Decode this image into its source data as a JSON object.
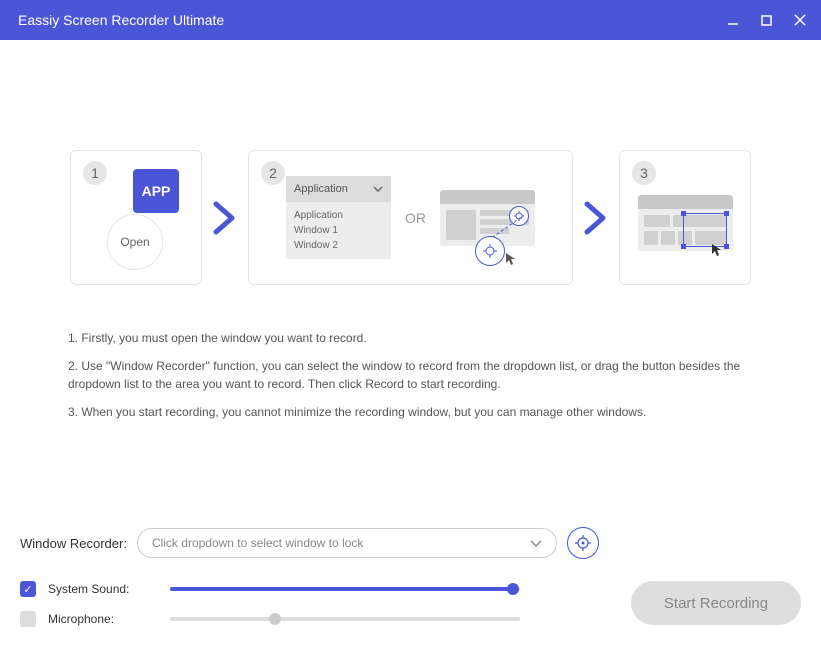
{
  "titlebar": {
    "title": "Eassiy Screen Recorder Ultimate"
  },
  "steps": {
    "s1": {
      "num": "1",
      "app_label": "APP",
      "open_label": "Open"
    },
    "s2": {
      "num": "2",
      "dd_header": "Application",
      "dd_item1": "Application",
      "dd_item2": "Window 1",
      "dd_item3": "Window 2",
      "or": "OR"
    },
    "s3": {
      "num": "3"
    }
  },
  "instructions": {
    "line1": "1. Firstly, you must open the window you want to record.",
    "line2": "2. Use \"Window Recorder\" function, you can select the window to record from the dropdown list, or drag the button besides the dropdown list to the area you want to record. Then click Record to start recording.",
    "line3": "3. When you start recording, you cannot minimize the recording window, but you can manage other windows."
  },
  "bottom": {
    "dd_label": "Window Recorder:",
    "dd_placeholder": "Click dropdown to select window to lock",
    "system_sound": "System Sound:",
    "microphone": "Microphone:",
    "start_btn": "Start Recording"
  }
}
